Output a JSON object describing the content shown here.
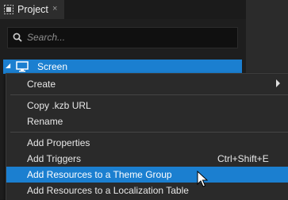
{
  "panel": {
    "tab_label": "Project",
    "tab_close": "×",
    "search_placeholder": "Search...",
    "tree_item": "Screen"
  },
  "menu": {
    "items": [
      {
        "label": "Create",
        "has_submenu": true
      },
      {
        "label": "Copy .kzb URL"
      },
      {
        "label": "Rename"
      },
      {
        "label": "Add Properties"
      },
      {
        "label": "Add Triggers",
        "shortcut": "Ctrl+Shift+E"
      },
      {
        "label": "Add Resources to a Theme Group",
        "highlighted": true
      },
      {
        "label": "Add Resources to a Localization Table"
      }
    ]
  },
  "colors": {
    "accent": "#1b7fd0",
    "menu_bg": "#2a2a2a",
    "panel_bg": "#1e1e1e"
  }
}
